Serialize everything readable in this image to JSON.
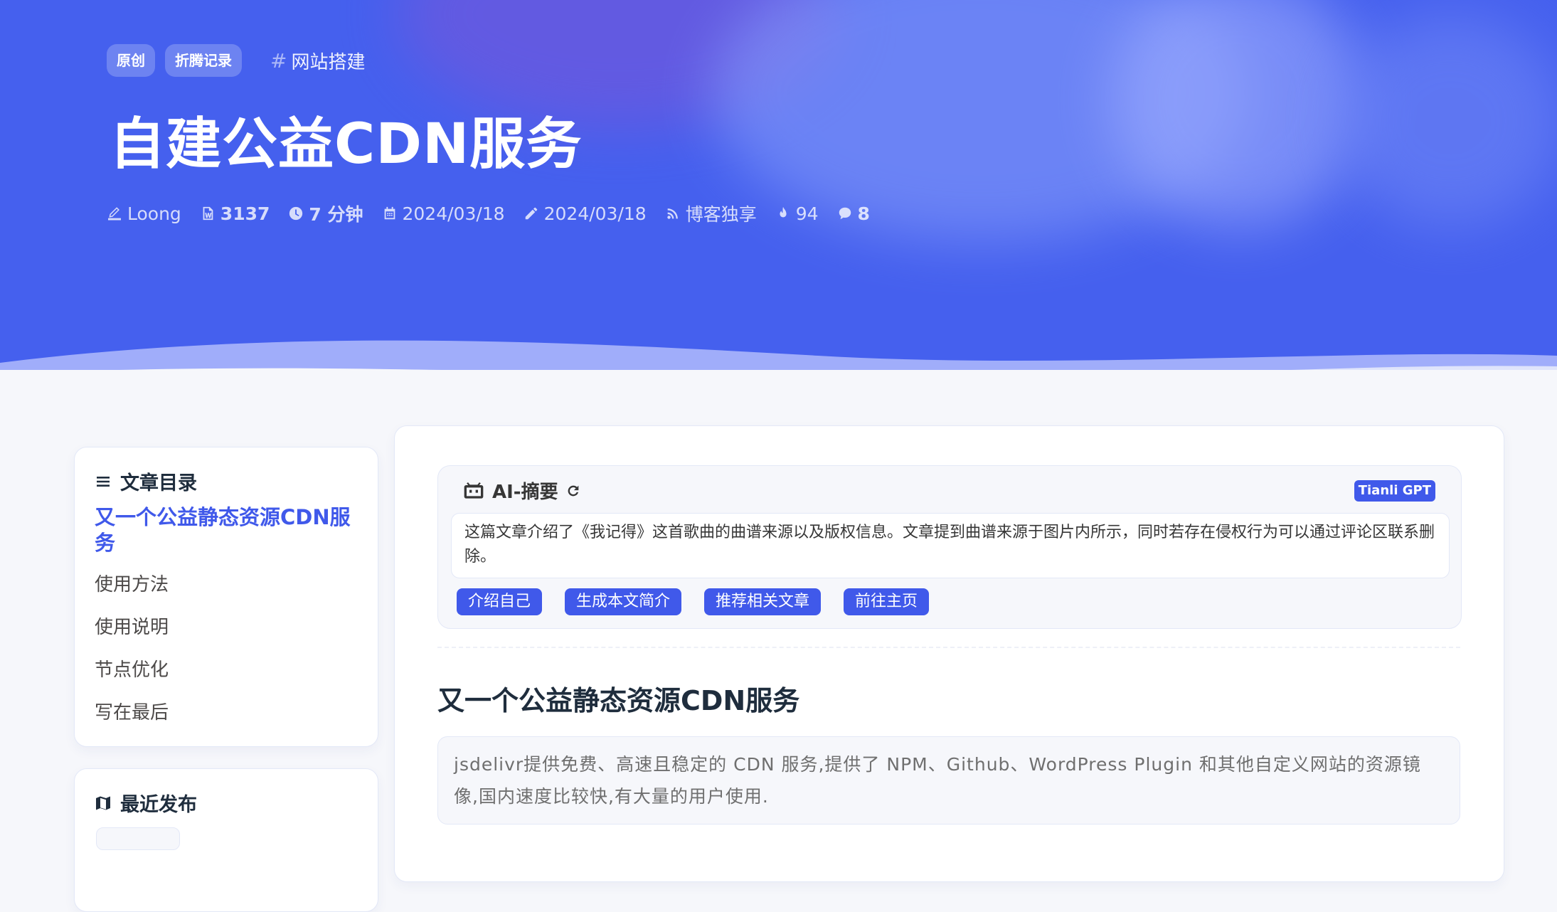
{
  "header": {
    "tags": [
      "原创",
      "折腾记录"
    ],
    "category": "网站搭建",
    "title": "自建公益CDN服务",
    "meta": {
      "author": "Loong",
      "word_count": "3137",
      "read_time": "7 分钟",
      "published": "2024/03/18",
      "updated": "2024/03/18",
      "source": "博客独享",
      "views": "94",
      "comments": "8"
    }
  },
  "sidebar": {
    "toc": {
      "title": "文章目录",
      "items": [
        {
          "label": "又一个公益静态资源CDN服务",
          "active": true
        },
        {
          "label": "使用方法"
        },
        {
          "label": "使用说明"
        },
        {
          "label": "节点优化"
        },
        {
          "label": "写在最后"
        }
      ]
    },
    "recent": {
      "title": "最近发布"
    }
  },
  "ai_summary": {
    "title": "AI-摘要",
    "badge": "Tianli GPT",
    "text": "这篇文章介绍了《我记得》这首歌曲的曲谱来源以及版权信息。文章提到曲谱来源于图片内所示，同时若存在侵权行为可以通过评论区联系删除。",
    "buttons": [
      "介绍自己",
      "生成本文简介",
      "推荐相关文章",
      "前往主页"
    ]
  },
  "article": {
    "heading": "又一个公益静态资源CDN服务",
    "quote": "jsdelivr提供免费、高速且稳定的 CDN 服务,提供了 NPM、Github、WordPress Plugin 和其他自定义网站的资源镜像,国内速度比较快,有大量的用户使用."
  },
  "colors": {
    "hero": "#4560ee",
    "accent": "#4059ea",
    "background": "#f6f7fb"
  },
  "icons": [
    "pen-icon",
    "word-count-icon",
    "clock-icon",
    "calendar-icon",
    "edit-pencil-icon",
    "rss-icon",
    "fire-icon",
    "comment-icon",
    "list-icon",
    "map-icon",
    "robot-icon",
    "refresh-icon"
  ]
}
